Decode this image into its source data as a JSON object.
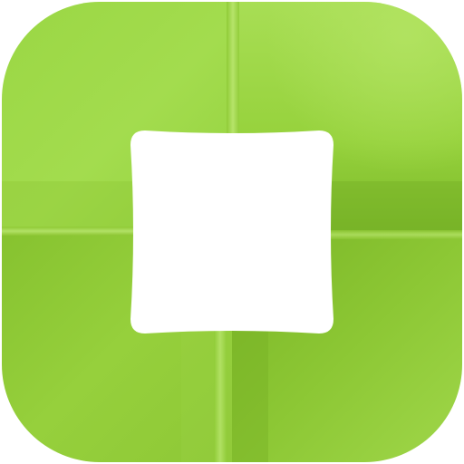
{
  "icon": {
    "name": "folded-green-square-frame-icon",
    "colors": {
      "light_green": "#a6dc50",
      "mid_green": "#90cc36",
      "dark_green": "#7ab828",
      "highlight": "#b8e56a",
      "center": "#ffffff"
    }
  }
}
